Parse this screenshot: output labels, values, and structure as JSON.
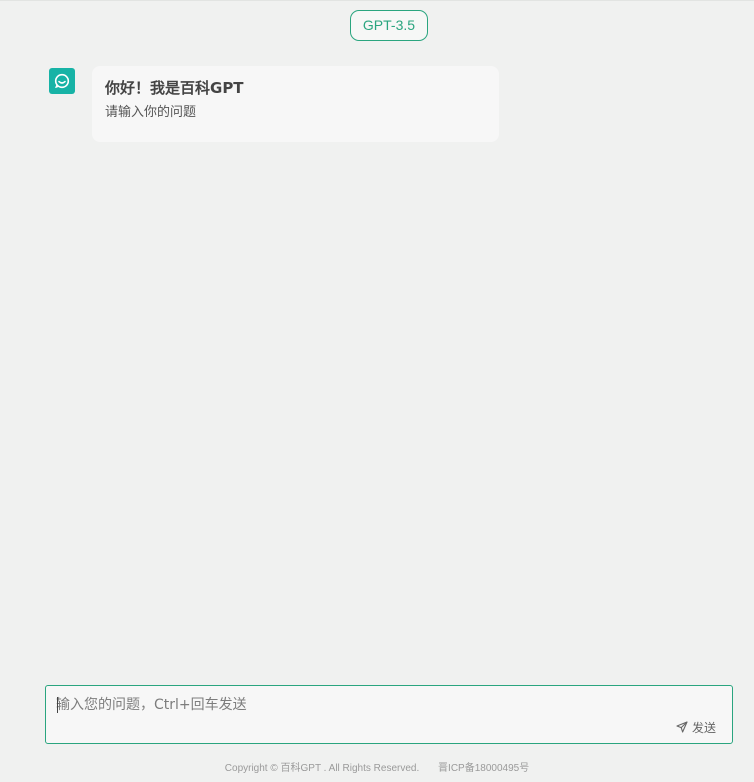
{
  "header": {
    "model_label": "GPT-3.5"
  },
  "chat": {
    "messages": [
      {
        "role": "assistant",
        "avatar_icon": "chat-smile-icon",
        "title": "你好！我是百科GPT",
        "text": "请输入你的问题"
      }
    ]
  },
  "composer": {
    "placeholder": "输入您的问题，Ctrl+回车发送",
    "value": "",
    "send_label": "发送",
    "send_icon": "paper-plane-icon"
  },
  "footer": {
    "copyright": "Copyright © 百科GPT . All Rights Reserved.",
    "icp": "晋ICP备18000495号"
  },
  "colors": {
    "accent": "#2aa57f",
    "avatar_bg": "#17b3a6",
    "page_bg": "#f0f1f0",
    "bubble_bg": "#f7f7f7"
  }
}
